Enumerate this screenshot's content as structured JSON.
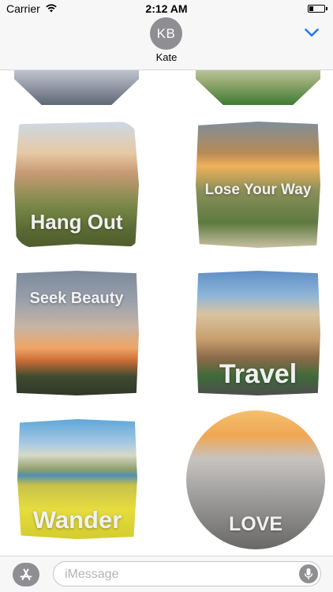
{
  "status_bar": {
    "carrier": "Carrier",
    "time": "2:12 AM"
  },
  "conversation": {
    "avatar_initials": "KB",
    "contact_name": "Kate"
  },
  "stickers": [
    {
      "label": "Hang Out"
    },
    {
      "label": "Lose Your Way"
    },
    {
      "label": "Seek Beauty"
    },
    {
      "label": "Travel"
    },
    {
      "label": "Wander"
    },
    {
      "label": "LOVE"
    }
  ],
  "input_bar": {
    "placeholder": "iMessage"
  },
  "colors": {
    "accent": "#1a7cf5",
    "header_bg": "#f7f7f8",
    "avatar_bg": "#8e8e93"
  },
  "icons": [
    "wifi-icon",
    "battery-icon",
    "chevron-down-icon",
    "app-store-icon",
    "microphone-icon"
  ]
}
